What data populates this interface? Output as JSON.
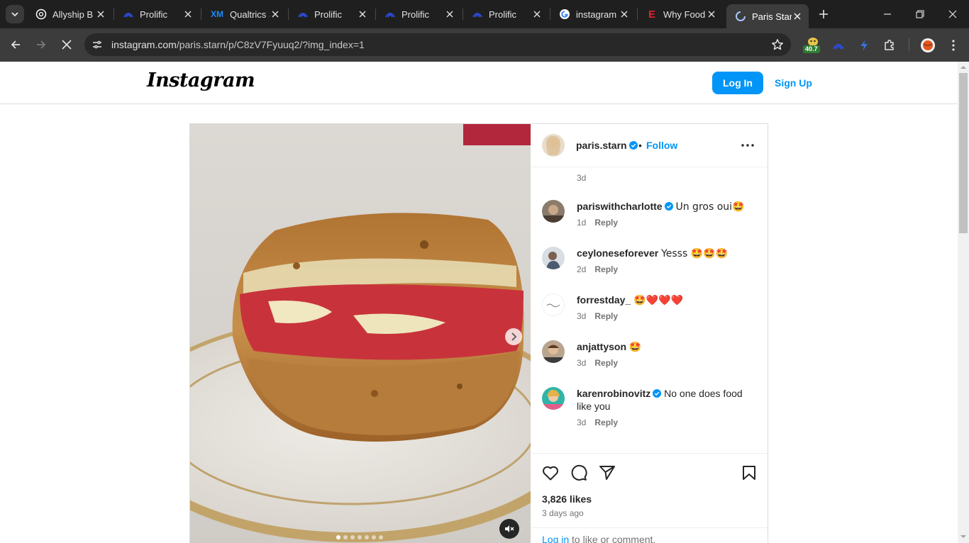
{
  "browser": {
    "tabs": [
      {
        "title": "Allyship B",
        "favicon": "openai-icon"
      },
      {
        "title": "Prolific",
        "favicon": "prolific-icon"
      },
      {
        "title": "Qualtrics S",
        "favicon": "xm-icon"
      },
      {
        "title": "Prolific",
        "favicon": "prolific-icon"
      },
      {
        "title": "Prolific",
        "favicon": "prolific-icon"
      },
      {
        "title": "Prolific",
        "favicon": "prolific-icon"
      },
      {
        "title": "instagram",
        "favicon": "google-icon"
      },
      {
        "title": "Why Food",
        "favicon": "e-icon"
      },
      {
        "title": "Paris Starn",
        "favicon": "loading-icon",
        "active": true
      }
    ],
    "url_host": "instagram.com",
    "url_path": "/paris.starn/p/C8zV7Fyuuq2/?img_index=1",
    "extension_badge": "40.7"
  },
  "header": {
    "logo": "Instagram",
    "login_label": "Log In",
    "signup_label": "Sign Up"
  },
  "post": {
    "owner": "paris.starn",
    "dot": "•",
    "follow_label": "Follow",
    "caption_time": "3d",
    "comments": [
      {
        "user": "pariswithcharlotte",
        "verified": true,
        "text": "Un gros oui🤩",
        "time": "1d",
        "reply": "Reply"
      },
      {
        "user": "ceyloneseforever",
        "verified": false,
        "text": "Yesss 🤩🤩🤩",
        "time": "2d",
        "reply": "Reply"
      },
      {
        "user": "forrestday_",
        "verified": false,
        "text": "🤩❤️❤️❤️",
        "time": "3d",
        "reply": "Reply"
      },
      {
        "user": "anjattyson",
        "verified": false,
        "text": "🤩",
        "time": "3d",
        "reply": "Reply"
      },
      {
        "user": "karenrobinovitz",
        "verified": true,
        "text": "No one does food like you",
        "time": "3d",
        "reply": "Reply"
      }
    ],
    "likes": "3,826 likes",
    "posted_ago": "3 days ago",
    "login_prompt_link": "Log in",
    "login_prompt_rest": " to like or comment.",
    "carousel_count": 7,
    "carousel_index": 1
  },
  "colors": {
    "accent": "#0095f6",
    "text": "#262626",
    "muted": "#737373"
  }
}
